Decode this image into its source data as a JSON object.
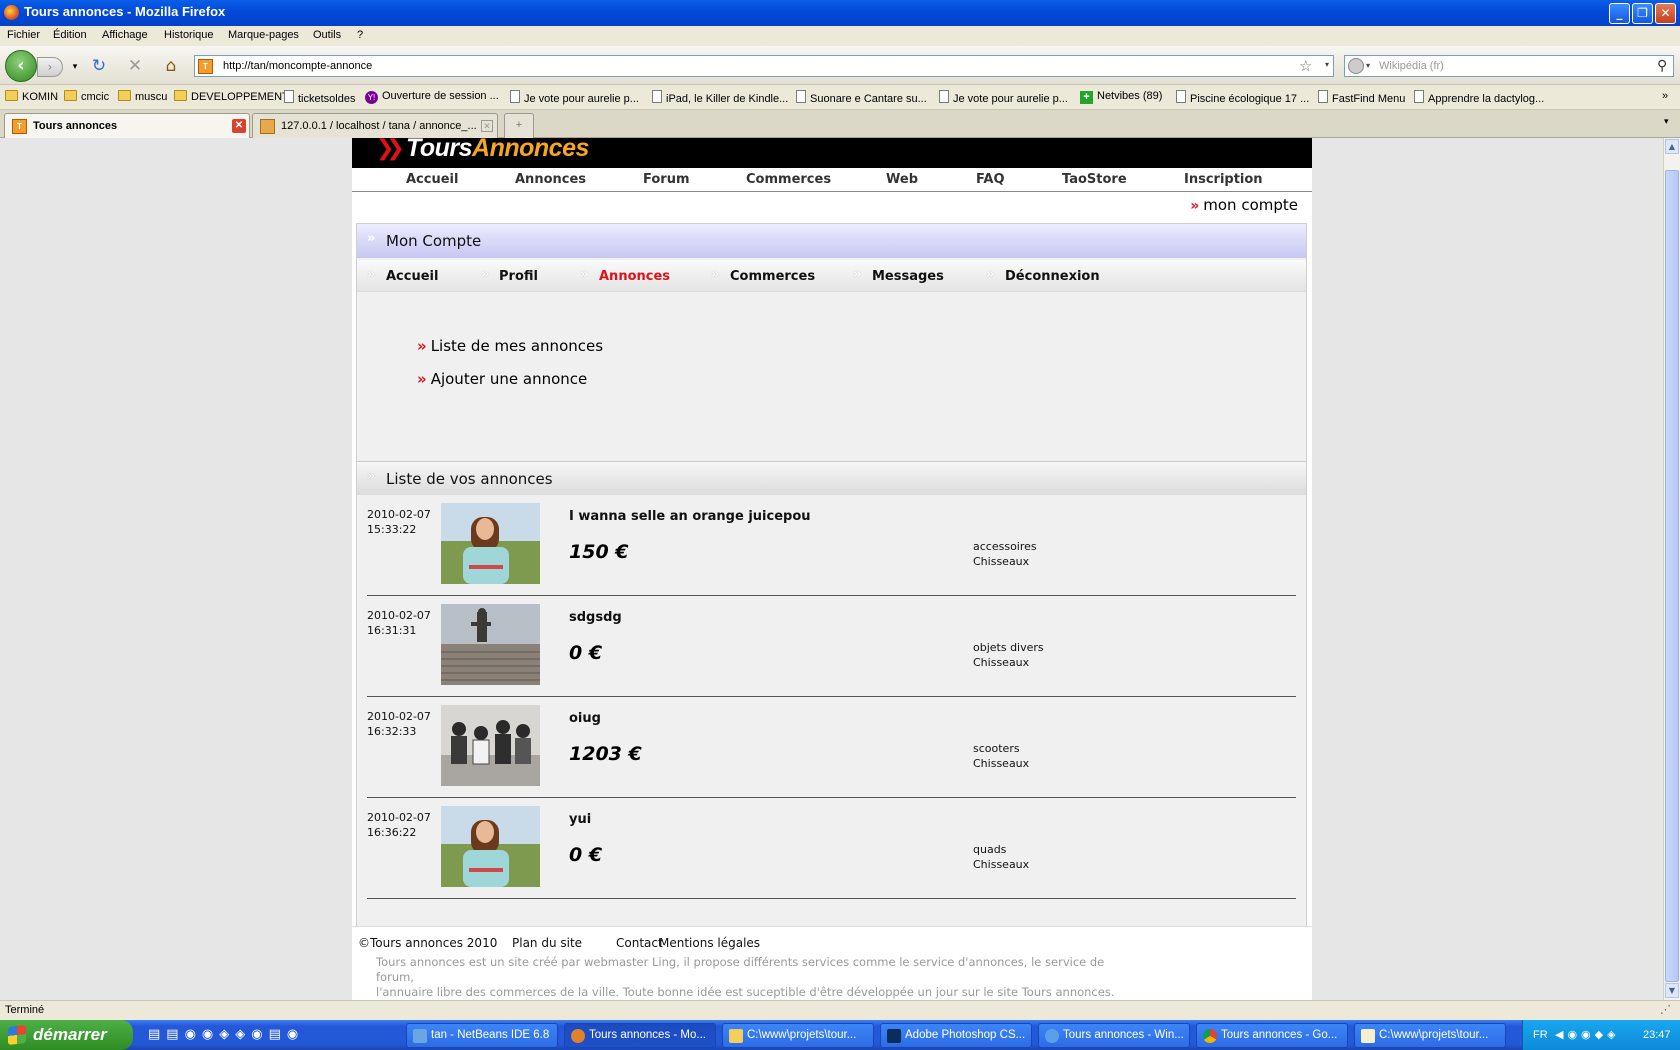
{
  "window": {
    "title": "Tours annonces - Mozilla Firefox"
  },
  "menu": [
    "Fichier",
    "Édition",
    "Affichage",
    "Historique",
    "Marque-pages",
    "Outils",
    "?"
  ],
  "url": "http://tan/moncompte-annonce",
  "search_placeholder": "Wikipédia (fr)",
  "bookmarks": [
    "KOMIN",
    "cmcic",
    "muscu",
    "DEVELOPPEMENT",
    "ticketsoldes",
    "Ouverture de session ...",
    "Je vote pour aurelie p...",
    "iPad, le Killer de Kindle...",
    "Suonare e Cantare su...",
    "Je vote pour aurelie p...",
    "Netvibes (89)",
    "Piscine écologique 17 ...",
    "FastFind Menu",
    "Apprendre la dactylog..."
  ],
  "tabs": [
    "Tours annonces",
    "127.0.0.1 / localhost / tana / annonce_..."
  ],
  "site": {
    "logo_part1": "Tours",
    "logo_part2": "Annonces",
    "nav": [
      "Accueil",
      "Annonces",
      "Forum",
      "Commerces",
      "Web",
      "FAQ",
      "TaoStore",
      "Inscription"
    ],
    "mon_compte_link": "mon compte",
    "box_title": "Mon Compte",
    "subnav": [
      "Accueil",
      "Profil",
      "Annonces",
      "Commerces",
      "Messages",
      "Déconnexion"
    ],
    "actions": [
      "Liste de mes annonces",
      "Ajouter une annonce"
    ],
    "list_title": "Liste de vos annonces",
    "ads": [
      {
        "date": "2010-02-07",
        "time": "15:33:22",
        "title": "I wanna selle an orange juicepou",
        "price": "150 €",
        "category": "accessoires",
        "city": "Chisseaux"
      },
      {
        "date": "2010-02-07",
        "time": "16:31:31",
        "title": "sdgsdg",
        "price": "0 €",
        "category": "objets divers",
        "city": "Chisseaux"
      },
      {
        "date": "2010-02-07",
        "time": "16:32:33",
        "title": "oiug",
        "price": "1203 €",
        "category": "scooters",
        "city": "Chisseaux"
      },
      {
        "date": "2010-02-07",
        "time": "16:36:22",
        "title": "yui",
        "price": "0 €",
        "category": "quads",
        "city": "Chisseaux"
      }
    ],
    "footer_links": [
      "©Tours annonces 2010",
      "Plan du site",
      "Contact",
      "Mentions légales"
    ],
    "footer_about_1": "Tours annonces est un site créé par webmaster Ling, il propose différents services comme le service d'annonces, le service de forum,",
    "footer_about_2": "l'annuaire libre des commerces de la ville. Toute bonne idée est suceptible d'être développée un jour sur le site Tours annonces."
  },
  "status": "Terminé",
  "taskbar": {
    "start": "démarrer",
    "tasks": [
      "tan - NetBeans IDE 6.8",
      "Tours annonces - Mo...",
      "C:\\www\\projets\\tour...",
      "Adobe Photoshop CS...",
      "Tours annonces - Win...",
      "Tours annonces - Go...",
      "C:\\www\\projets\\tour..."
    ],
    "lang": "FR",
    "clock": "23:47"
  },
  "colors": {
    "accent_red": "#e0101a",
    "logo_orange": "#f5a623",
    "title_bar": "#0349d8"
  }
}
